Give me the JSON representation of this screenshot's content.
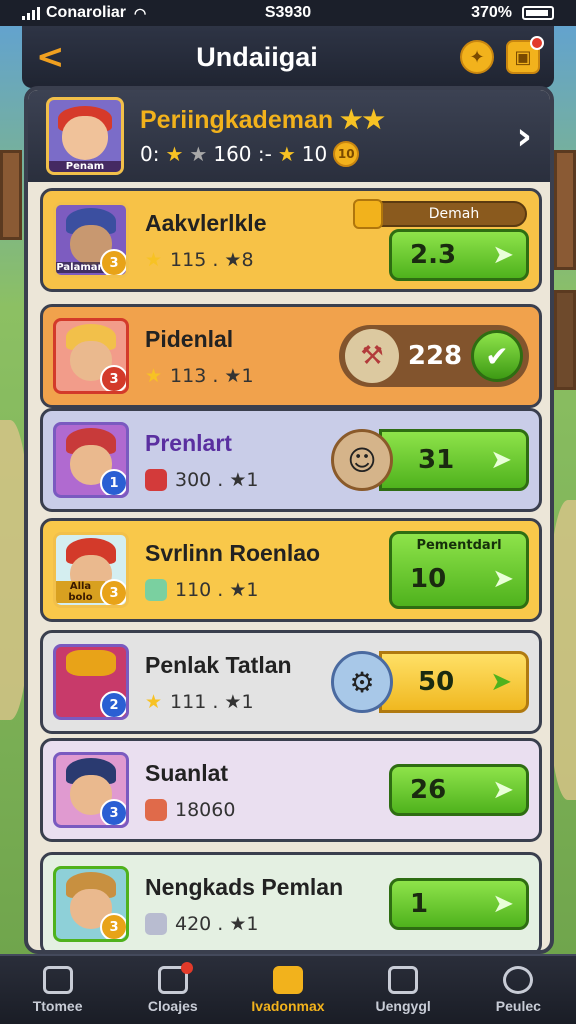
{
  "status_bar": {
    "carrier": "Conaroliar",
    "time": "S3930",
    "battery": "370%"
  },
  "header": {
    "title": "Undaiigai"
  },
  "profile": {
    "name": "Periingkademan",
    "portrait_tag": "Penam",
    "sub_left": "0:",
    "sub_mid": "160 :-",
    "sub_val": "10",
    "coin_label": "10"
  },
  "rows": [
    {
      "name": "Aakvlerlkle",
      "portrait_tag": "Palaman",
      "level": "3",
      "stat": "115 . ★8",
      "pill": "Demah",
      "action_value": "2.3",
      "bg": "#f7c247",
      "level_color": "#e8a318"
    },
    {
      "name": "Pidenlal",
      "level": "3",
      "stat": "113 . ★1",
      "slot_value": "228",
      "bg": "#f1a24c",
      "level_color": "#d33a2a"
    },
    {
      "name": "Prenlart",
      "level": "1",
      "stat": "300 . ★1",
      "action_value": "31",
      "bg": "#c9cde8",
      "level_color": "#2a5fd3"
    },
    {
      "name": "Svrlinn Roenlao",
      "portrait_tag": "Alla bolo",
      "level": "3",
      "stat": "110 . ★1",
      "action_label": "Pementdarl",
      "action_value": "10",
      "bg": "#f9c84a",
      "level_color": "#e8a318"
    },
    {
      "name": "Penlak Tatlan",
      "level": "2",
      "stat": "111 . ★1",
      "action_value": "50",
      "bg": "#e3e3e3",
      "level_color": "#2a5fd3"
    },
    {
      "name": "Suanlat",
      "level": "3",
      "stat": "18060",
      "action_value": "26",
      "bg": "#eadff0",
      "level_color": "#2a5fd3"
    },
    {
      "name": "Nengkads Pemlan",
      "level": "3",
      "stat": "420 . ★1",
      "action_value": "1",
      "bg": "#e4f0e2",
      "level_color": "#e8a318"
    }
  ],
  "nav": [
    {
      "label": "Ttomee"
    },
    {
      "label": "Cloajes"
    },
    {
      "label": "Ivadonmax"
    },
    {
      "label": "Uengygl"
    },
    {
      "label": "Peulec"
    }
  ],
  "colors": {
    "accent": "#f2b21c",
    "green": "#4fb21d",
    "dark": "#2a2f3d"
  },
  "icons": [
    "back-arrow-icon",
    "coin-icon",
    "chest-icon",
    "star-icon",
    "gem-icon",
    "arrow-right-icon",
    "check-icon",
    "home-icon",
    "clan-icon",
    "shop-icon",
    "chat-icon",
    "profile-icon"
  ]
}
